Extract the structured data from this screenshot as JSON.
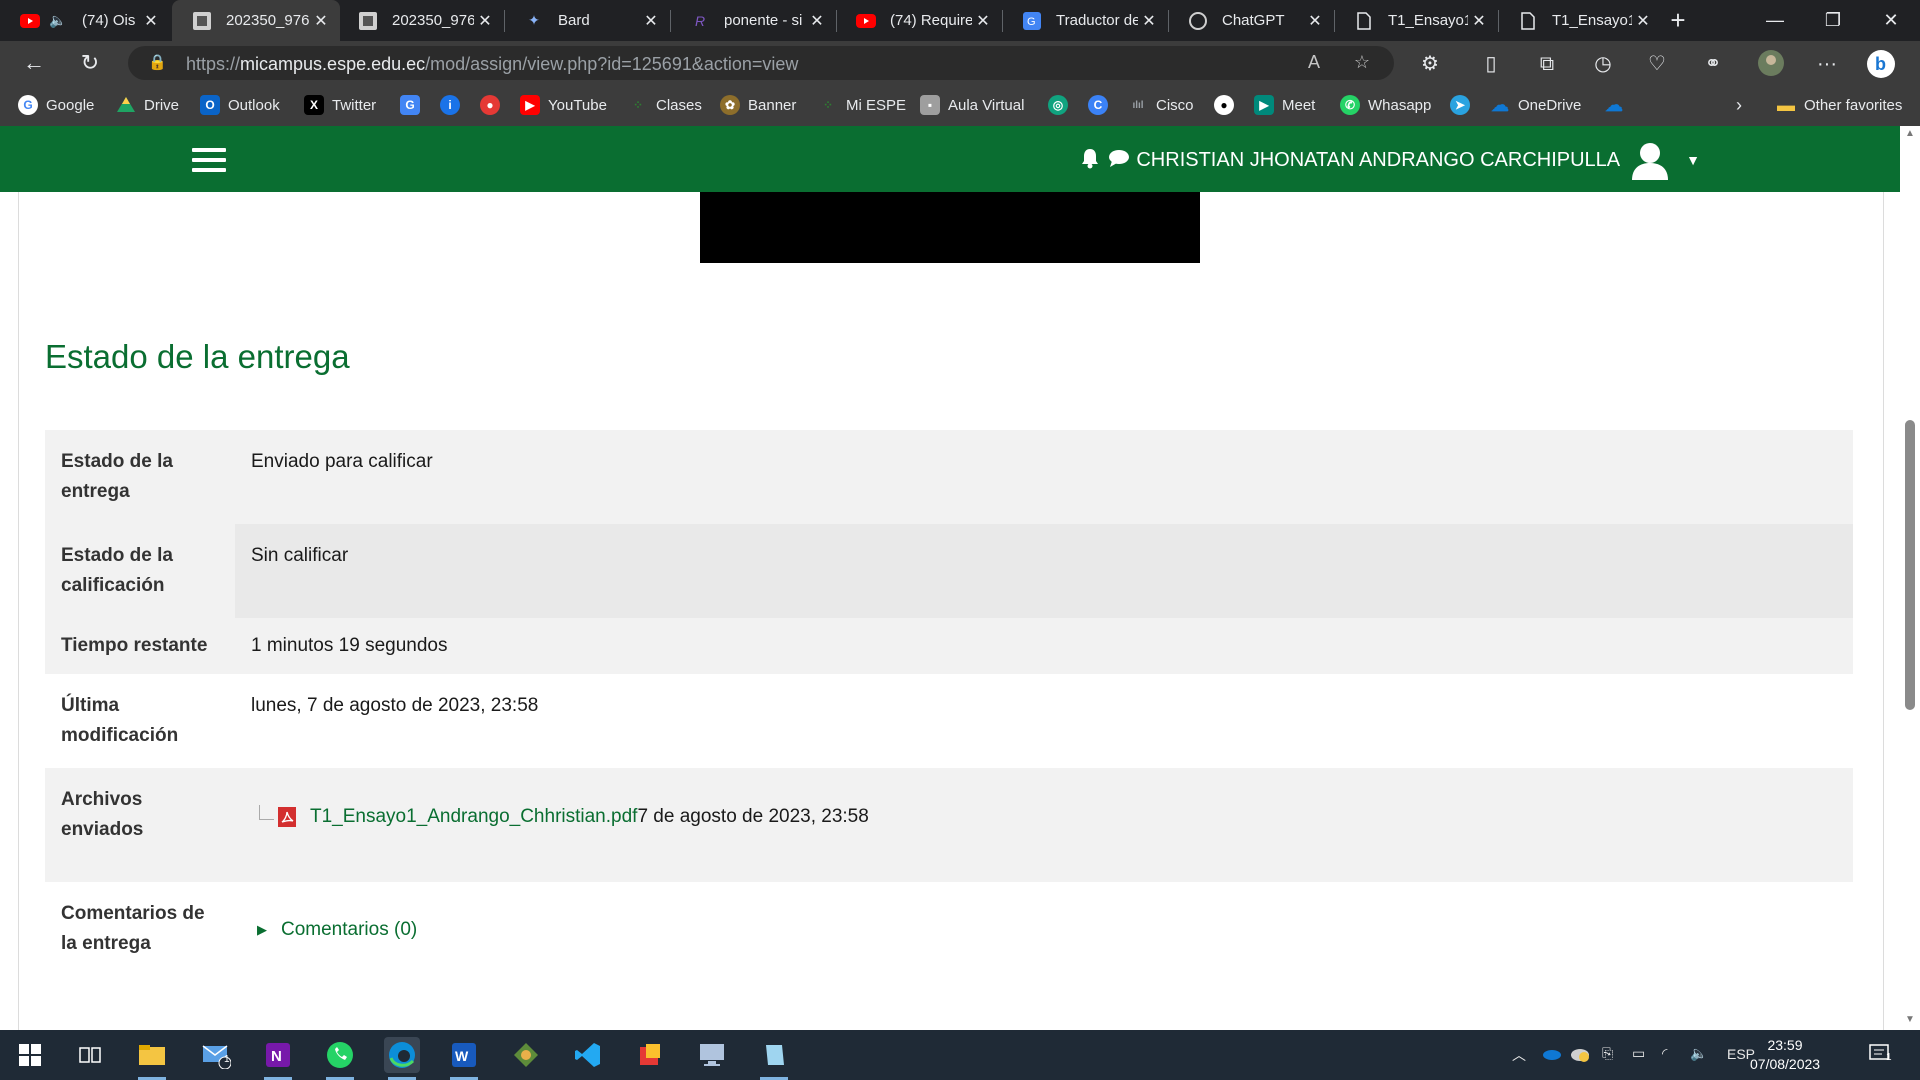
{
  "browser": {
    "tabs": [
      {
        "label": "(74) Ois",
        "icon": "youtube-icon",
        "muted": true
      },
      {
        "label": "202350_976",
        "icon": "espe-icon",
        "active": true
      },
      {
        "label": "202350_976",
        "icon": "espe-icon"
      },
      {
        "label": "Bard",
        "icon": "bard-icon"
      },
      {
        "label": "ponente - si",
        "icon": "r-icon"
      },
      {
        "label": "(74) Requirer",
        "icon": "youtube-icon"
      },
      {
        "label": "Traductor de",
        "icon": "translate-icon"
      },
      {
        "label": "ChatGPT",
        "icon": "chatgpt-icon"
      },
      {
        "label": "T1_Ensayo1_",
        "icon": "document-icon"
      },
      {
        "label": "T1_Ensayo1_",
        "icon": "document-icon"
      }
    ],
    "address": {
      "prefix": "https://",
      "domain": "micampus.espe.edu.ec",
      "path": "/mod/assign/view.php?id=125691&action=view"
    },
    "bookmarks": [
      {
        "label": "Google",
        "icon": "google-icon",
        "color": "#4285f4"
      },
      {
        "label": "Drive",
        "icon": "drive-icon",
        "color": "#1fa463"
      },
      {
        "label": "Outlook",
        "icon": "outlook-icon",
        "color": "#0a64c8"
      },
      {
        "label": "Twitter",
        "icon": "x-icon",
        "color": "#000000"
      },
      {
        "label": "",
        "icon": "translate-icon",
        "color": "#4285f4"
      },
      {
        "label": "",
        "icon": "info-icon",
        "color": "#1a73e8"
      },
      {
        "label": "",
        "icon": "record-icon",
        "color": "#e53935"
      },
      {
        "label": "YouTube",
        "icon": "youtube-icon",
        "color": "#ff0000"
      },
      {
        "label": "Clases",
        "icon": "clases-icon",
        "color": "#2e7d32"
      },
      {
        "label": "Banner",
        "icon": "banner-icon",
        "color": "#8d6e2b"
      },
      {
        "label": "Mi ESPE",
        "icon": "miespe-icon",
        "color": "#2e7d32"
      },
      {
        "label": "Aula Virtual",
        "icon": "aula-icon",
        "color": "#9e9e9e"
      },
      {
        "label": "",
        "icon": "chatgpt-icon",
        "color": "#10a37f"
      },
      {
        "label": "",
        "icon": "c-icon",
        "color": "#3b82f6"
      },
      {
        "label": "Cisco",
        "icon": "cisco-icon",
        "color": "#5f6368"
      },
      {
        "label": "",
        "icon": "github-icon",
        "color": "#ffffff"
      },
      {
        "label": "Meet",
        "icon": "meet-icon",
        "color": "#00897b"
      },
      {
        "label": "Whasapp",
        "icon": "whatsapp-icon",
        "color": "#25d366"
      },
      {
        "label": "",
        "icon": "telegram-icon",
        "color": "#2aa3e0"
      },
      {
        "label": "OneDrive",
        "icon": "onedrive-icon",
        "color": "#0f78d4"
      },
      {
        "label": "",
        "icon": "onedrive-icon",
        "color": "#0f78d4"
      }
    ],
    "other_favorites": "Other favorites"
  },
  "page": {
    "user_name": "CHRISTIAN JHONATAN ANDRANGO CARCHIPULLA",
    "section_title": "Estado de la entrega",
    "rows": {
      "status_label": "Estado de la entrega",
      "status_value": "Enviado para calificar",
      "grade_label": "Estado de la calificación",
      "grade_value": "Sin calificar",
      "time_label": "Tiempo restante",
      "time_value": "1 minutos 19 segundos",
      "modified_label": "Última modificación",
      "modified_value": "lunes, 7 de agosto de 2023, 23:58",
      "files_label": "Archivos enviados",
      "file_name": "T1_Ensayo1_Andrango_Chhristian.pdf",
      "file_date": "7 de agosto de 2023, 23:58",
      "comments_label": "Comentarios de la entrega",
      "comments_link": "Comentarios (0)"
    },
    "colors": {
      "brand_green": "#0a6e31"
    }
  },
  "taskbar": {
    "language": "ESP",
    "time": "23:59",
    "date": "07/08/2023",
    "mail_badge": "1",
    "notification_badge": "1"
  }
}
